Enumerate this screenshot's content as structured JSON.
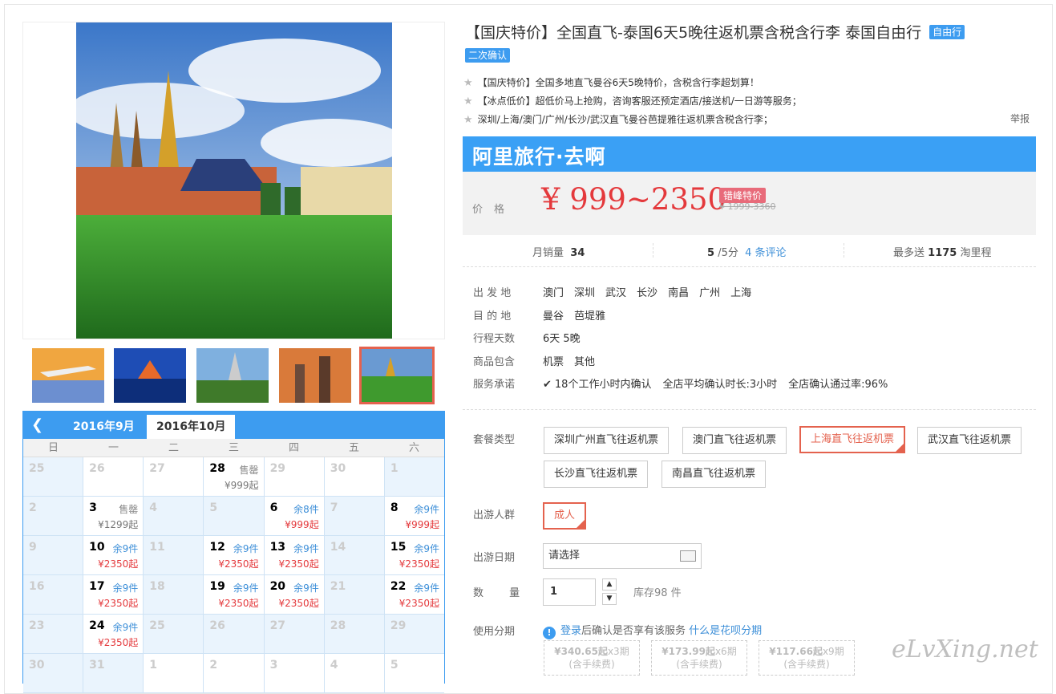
{
  "product": {
    "title": "【国庆特价】全国直飞-泰国6天5晚往返机票含税含行李 泰国自由行",
    "tag_free": "自由行",
    "tag_confirm": "二次确认",
    "selling_points": [
      "【国庆特价】全国多地直飞曼谷6天5晚特价，含税含行李超划算！",
      "【冰点低价】超低价马上抢购，咨询客服还预定酒店/接送机/一日游等服务；",
      "深圳/上海/澳门/广州/长沙/武汉直飞曼谷芭提雅往返机票含税含行李；"
    ],
    "report": "举报"
  },
  "brand": "阿里旅行·去啊",
  "price": {
    "label": "价格",
    "value": "¥ 999~2350",
    "badge": "错峰特价",
    "original": "¥ 1999-3360"
  },
  "stats": {
    "sales_label": "月销量",
    "sales": "34",
    "score": "5",
    "score_suffix": "/5分",
    "reviews": "4 条评论",
    "points_prefix": "最多送",
    "points": "1175",
    "points_suffix": "淘里程"
  },
  "info": {
    "depart_label": "出 发 地",
    "depart": [
      "澳门",
      "深圳",
      "武汉",
      "长沙",
      "南昌",
      "广州",
      "上海"
    ],
    "dest_label": "目 的 地",
    "dest": [
      "曼谷",
      "芭堤雅"
    ],
    "days_label": "行程天数",
    "days": "6天 5晚",
    "include_label": "商品包含",
    "include": [
      "机票",
      "其他"
    ],
    "service_label": "服务承诺",
    "service": [
      "18个工作小时内确认",
      "全店平均确认时长:3小时",
      "全店确认通过率:96%"
    ]
  },
  "options": {
    "package_label": "套餐类型",
    "packages": [
      "深圳广州直飞往返机票",
      "澳门直飞往返机票",
      "上海直飞往返机票",
      "武汉直飞往返机票",
      "长沙直飞往返机票",
      "南昌直飞往返机票"
    ],
    "selected_package": "上海直飞往返机票",
    "crowd_label": "出游人群",
    "crowd": "成人",
    "date_label": "出游日期",
    "date_placeholder": "请选择",
    "qty_label": "数 量",
    "qty": "1",
    "stock": "库存98 件",
    "installment_label": "使用分期",
    "huabei_login": "登录",
    "huabei_text": "后确认是否享有该服务",
    "huabei_link": "什么是花呗分期",
    "installments": [
      {
        "amount": "¥340.65起",
        "period": "x3期",
        "note": "(含手续费)"
      },
      {
        "amount": "¥173.99起",
        "period": "x6期",
        "note": "(含手续费)"
      },
      {
        "amount": "¥117.66起",
        "period": "x9期",
        "note": "(含手续费)"
      }
    ]
  },
  "calendar": {
    "tabs": [
      "2016年9月",
      "2016年10月"
    ],
    "active_tab": "2016年10月",
    "weekdays": [
      "日",
      "一",
      "二",
      "三",
      "四",
      "五",
      "六"
    ],
    "weeks": [
      [
        {
          "d": "25",
          "off": true
        },
        {
          "d": "26",
          "off": false
        },
        {
          "d": "27",
          "off": false
        },
        {
          "d": "28",
          "on": true,
          "s": "售罄",
          "p": "¥999起",
          "grey": true
        },
        {
          "d": "29",
          "off": false
        },
        {
          "d": "30",
          "off": false
        },
        {
          "d": "1",
          "off": true
        }
      ],
      [
        {
          "d": "2",
          "off": true
        },
        {
          "d": "3",
          "on": true,
          "s": "售罄",
          "p": "¥1299起",
          "grey": true
        },
        {
          "d": "4",
          "off": true
        },
        {
          "d": "5",
          "off": true
        },
        {
          "d": "6",
          "on": true,
          "s": "余8件",
          "p": "¥999起"
        },
        {
          "d": "7",
          "off": true
        },
        {
          "d": "8",
          "on": true,
          "s": "余9件",
          "p": "¥999起"
        }
      ],
      [
        {
          "d": "9",
          "off": true
        },
        {
          "d": "10",
          "on": true,
          "s": "余9件",
          "p": "¥2350起"
        },
        {
          "d": "11",
          "off": true
        },
        {
          "d": "12",
          "on": true,
          "s": "余9件",
          "p": "¥2350起"
        },
        {
          "d": "13",
          "on": true,
          "s": "余9件",
          "p": "¥2350起"
        },
        {
          "d": "14",
          "off": true
        },
        {
          "d": "15",
          "on": true,
          "s": "余9件",
          "p": "¥2350起"
        }
      ],
      [
        {
          "d": "16",
          "off": true
        },
        {
          "d": "17",
          "on": true,
          "s": "余9件",
          "p": "¥2350起"
        },
        {
          "d": "18",
          "off": true
        },
        {
          "d": "19",
          "on": true,
          "s": "余9件",
          "p": "¥2350起"
        },
        {
          "d": "20",
          "on": true,
          "s": "余9件",
          "p": "¥2350起"
        },
        {
          "d": "21",
          "off": true
        },
        {
          "d": "22",
          "on": true,
          "s": "余9件",
          "p": "¥2350起"
        }
      ],
      [
        {
          "d": "23",
          "off": true
        },
        {
          "d": "24",
          "on": true,
          "s": "余9件",
          "p": "¥2350起"
        },
        {
          "d": "25",
          "off": true
        },
        {
          "d": "26",
          "off": true
        },
        {
          "d": "27",
          "off": true
        },
        {
          "d": "28",
          "off": true
        },
        {
          "d": "29",
          "off": true
        }
      ],
      [
        {
          "d": "30",
          "off": true
        },
        {
          "d": "31",
          "off": true
        },
        {
          "d": "1",
          "off": false
        },
        {
          "d": "2",
          "off": false
        },
        {
          "d": "3",
          "off": false
        },
        {
          "d": "4",
          "off": false
        },
        {
          "d": "5",
          "off": false
        }
      ]
    ]
  },
  "watermark": "eLvXing.net",
  "colors": {
    "accent": "#3d9cf0",
    "price": "#e4393c",
    "selected": "#e4624e"
  }
}
